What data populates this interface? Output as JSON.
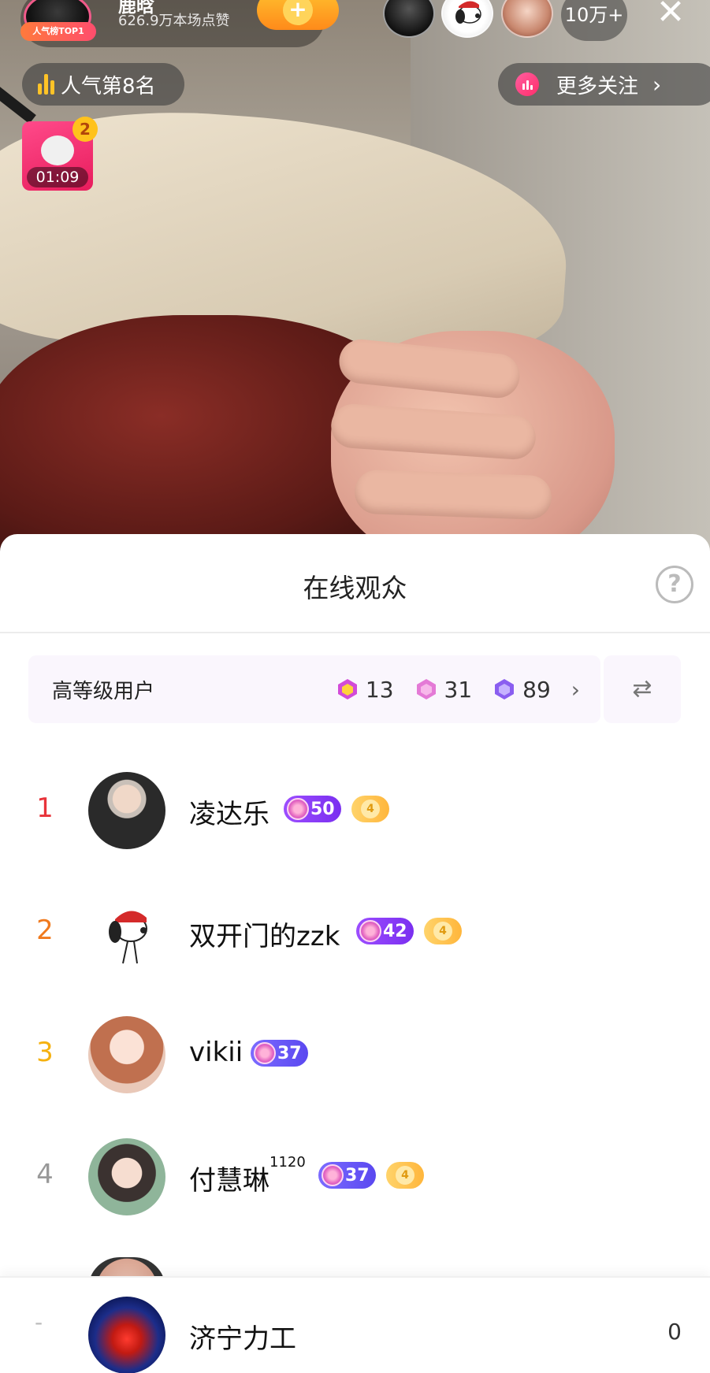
{
  "host": {
    "name": "鹿晗",
    "likes": "626.9万本场点赞",
    "badge": "人气榜TOP1"
  },
  "header": {
    "viewer_count": "10万+",
    "popularity_rank": "人气第8名",
    "more_follow": "更多关注"
  },
  "gift": {
    "count": "2",
    "timer": "01:09"
  },
  "sheet": {
    "title": "在线观众",
    "level_bar": {
      "label": "高等级用户",
      "stats": [
        "13",
        "31",
        "89"
      ]
    },
    "viewers": [
      {
        "rank": "1",
        "name": "凌达乐",
        "sup": "",
        "level": "50",
        "fan_badge": "4",
        "rank_color": "#e8333a"
      },
      {
        "rank": "2",
        "name": "双开门的zzk",
        "sup": "",
        "level": "42",
        "fan_badge": "4",
        "rank_color": "#f07a1e"
      },
      {
        "rank": "3",
        "name": "vikii",
        "sup": "",
        "level": "37",
        "fan_badge": "",
        "rank_color": "#f5b10f"
      },
      {
        "rank": "4",
        "name": "付慧琳",
        "sup": "1120",
        "level": "37",
        "fan_badge": "4",
        "rank_color": "#999999"
      }
    ],
    "self": {
      "rank": "-",
      "name": "济宁力工",
      "score": "0"
    }
  },
  "icons": [
    "close-icon",
    "chart-bars-icon",
    "chevron-right-icon",
    "help-icon",
    "swap-icon",
    "level-gem-icon",
    "fan-badge-icon"
  ]
}
